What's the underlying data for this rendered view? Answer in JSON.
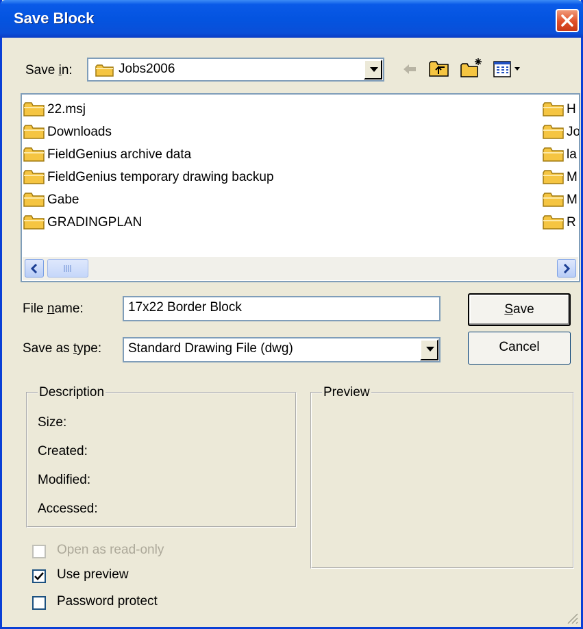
{
  "window": {
    "title": "Save Block"
  },
  "save_in": {
    "label_pre": "Save ",
    "label_key": "i",
    "label_post": "n:",
    "value": "Jobs2006"
  },
  "files_left": [
    "22.msj",
    "Downloads",
    "FieldGenius archive data",
    "FieldGenius temporary drawing backup",
    "Gabe",
    "GRADINGPLAN"
  ],
  "files_right": [
    "H",
    "Jo",
    "la",
    "M",
    "M",
    "R"
  ],
  "file_name": {
    "label_pre": "File ",
    "label_key": "n",
    "label_post": "ame:",
    "value": "17x22 Border Block"
  },
  "save_as_type": {
    "label_pre": "Save as ",
    "label_key": "t",
    "label_post": "ype:",
    "value": "Standard Drawing File (dwg)"
  },
  "buttons": {
    "save_key": "S",
    "save_rest": "ave",
    "cancel": "Cancel"
  },
  "description": {
    "title": "Description",
    "size": "Size:",
    "created": "Created:",
    "modified": "Modified:",
    "accessed": "Accessed:"
  },
  "preview": {
    "title": "Preview"
  },
  "options": {
    "open_read_only": {
      "label": "Open as read-only",
      "checked": false,
      "enabled": false
    },
    "use_preview": {
      "label": "Use preview",
      "checked": true,
      "enabled": true
    },
    "password_protect": {
      "label": "Password protect",
      "checked": false,
      "enabled": true
    }
  },
  "colors": {
    "titlebar": "#0454e0",
    "dialog_bg": "#ece9d8",
    "folder": "#f5c542"
  },
  "icons": [
    "close-icon",
    "folder-icon",
    "back-arrow-icon",
    "up-folder-icon",
    "new-folder-icon",
    "views-menu-icon",
    "chevron-down-icon",
    "scroll-left-icon",
    "scroll-right-icon",
    "checkmark-icon",
    "resize-grip-icon"
  ]
}
